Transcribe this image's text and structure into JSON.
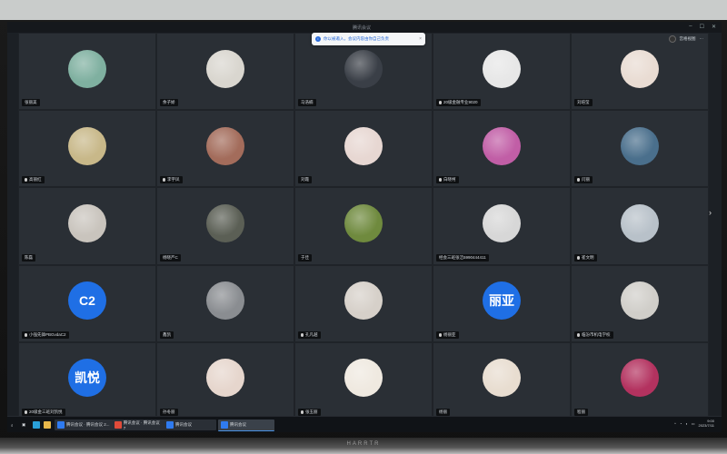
{
  "window": {
    "title": "腾讯会议"
  },
  "toast": {
    "text": "你以被邀入，会议内容由你自己负责",
    "close": "×"
  },
  "topright": {
    "label": "宫格视图"
  },
  "participants": [
    {
      "name": "张丽美",
      "avatar": "photo",
      "color": "#7fb0a0",
      "mic": false
    },
    {
      "name": "余子娇",
      "avatar": "photo",
      "color": "#d9d6cf",
      "mic": false
    },
    {
      "name": "马浩楠",
      "avatar": "photo",
      "color": "#3a3f47",
      "mic": false
    },
    {
      "name": "20级金融专业9020",
      "avatar": "photo",
      "color": "#e7e7e7",
      "mic": true
    },
    {
      "name": "刘培莹",
      "avatar": "photo",
      "color": "#e9dcd3",
      "mic": false
    },
    {
      "name": "高丽红",
      "avatar": "photo",
      "color": "#c8b889",
      "mic": true
    },
    {
      "name": "李宇凤",
      "avatar": "photo",
      "color": "#a36c5b",
      "mic": true
    },
    {
      "name": "刘霞",
      "avatar": "photo",
      "color": "#e7d7d2",
      "mic": false
    },
    {
      "name": "白晓柯",
      "avatar": "photo",
      "color": "#c15ea6",
      "mic": true
    },
    {
      "name": "闫丽",
      "avatar": "photo",
      "color": "#4a6f8c",
      "mic": true
    },
    {
      "name": "陈磊",
      "avatar": "photo",
      "color": "#c9c4bd",
      "mic": false
    },
    {
      "name": "杨晓严C",
      "avatar": "photo",
      "color": "#5b5f55",
      "mic": false
    },
    {
      "name": "于佳",
      "avatar": "photo",
      "color": "#6f8a3e",
      "mic": false
    },
    {
      "name": "经会三班张洁5990444411",
      "avatar": "photo",
      "color": "#d7d7d7",
      "mic": false
    },
    {
      "name": "崔文明",
      "avatar": "photo",
      "color": "#b8c1c9",
      "mic": true
    },
    {
      "name": "小强先锋PBGvdaC2",
      "avatar": "text",
      "text": "C2",
      "mic": true
    },
    {
      "name": "鑫凯",
      "avatar": "photo",
      "color": "#8a8d91",
      "mic": false
    },
    {
      "name": "孔凡越",
      "avatar": "photo",
      "color": "#d6d0c9",
      "mic": true
    },
    {
      "name": "杨丽亚",
      "avatar": "text",
      "text": "丽亚",
      "mic": true
    },
    {
      "name": "临汾市机电学校",
      "avatar": "photo",
      "color": "#d0cec9",
      "mic": true
    },
    {
      "name": "20级金三班刘凯悦",
      "avatar": "text",
      "text": "凯悦",
      "mic": true
    },
    {
      "name": "孙冬丽",
      "avatar": "photo",
      "color": "#e6d6cd",
      "mic": false
    },
    {
      "name": "张玉丽",
      "avatar": "photo",
      "color": "#efe9e0",
      "mic": true
    },
    {
      "name": "杨丽",
      "avatar": "photo",
      "color": "#e8ddd0",
      "mic": false
    },
    {
      "name": "程丽",
      "avatar": "photo",
      "color": "#b3325f",
      "mic": false
    }
  ],
  "taskbar": {
    "apps": [
      {
        "label": "腾讯会议 · 腾讯会议 2...",
        "color": "#2f7bf0"
      },
      {
        "label": "腾讯会议 · 腾讯会议 7",
        "color": "#e04b3a"
      },
      {
        "label": "腾讯会议",
        "color": "#2f7bf0"
      },
      {
        "label": "腾讯会议",
        "color": "#2f7bf0"
      }
    ],
    "time": "9:00",
    "date": "2023/7/11"
  }
}
